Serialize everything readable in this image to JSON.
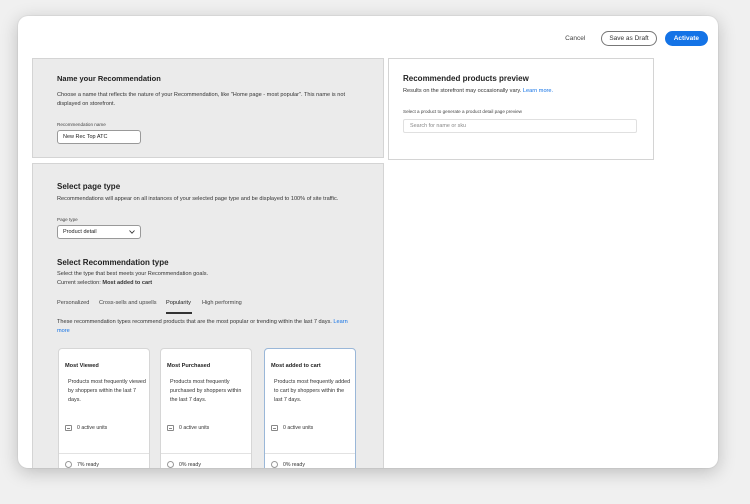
{
  "toolbar": {
    "cancel_label": "Cancel",
    "draft_label": "Save as Draft",
    "activate_label": "Activate"
  },
  "name_section": {
    "title": "Name your Recommendation",
    "description_line1": "Choose a name that reflects the nature of your Recommendation, like \"Home page - most popular\". This name is not",
    "description_line2": "displayed on storefront.",
    "field_label": "Recommendation name",
    "field_value": "New Rec Top ATC"
  },
  "preview": {
    "title": "Recommended products preview",
    "note": "Results on the storefront may occasionally vary.",
    "note_link": "Learn more.",
    "select_label": "Select a product to generate a product detail page preview",
    "search_placeholder": "Search for name or sku"
  },
  "page_type_section": {
    "title": "Select page type",
    "description": "Recommendations will appear on all instances of your selected page type and be displayed to 100% of site traffic.",
    "field_label": "Page type",
    "selected_value": "Product detail"
  },
  "rec_type_section": {
    "title": "Select Recommendation type",
    "description": "Select the type that best meets your Recommendation goals.",
    "current_prefix": "Current selection:",
    "current_value": "Most added to cart",
    "tabs": [
      "Personalized",
      "Cross-sells and upsells",
      "Popularity",
      "High performing"
    ],
    "active_tab": "Popularity",
    "tab_description": "These recommendation types recommend products that are the most popular or trending within the last 7 days.",
    "tab_link_part1": "Learn",
    "tab_link_part2": "more",
    "cards": [
      {
        "title": "Most Viewed",
        "description": "Products most frequently viewed by shoppers within the last 7 days.",
        "units": "0 active units",
        "ready": "7% ready"
      },
      {
        "title": "Most Purchased",
        "description": "Products most frequently purchased by shoppers within the last 7 days.",
        "units": "0 active units",
        "ready": "0% ready"
      },
      {
        "title": "Most added to cart",
        "description": "Products most frequently added to cart by shoppers within the last 7 days.",
        "units": "0 active units",
        "ready": "0% ready"
      }
    ]
  },
  "colors": {
    "accent": "#1473e6",
    "panel_bg": "#ebebeb"
  }
}
